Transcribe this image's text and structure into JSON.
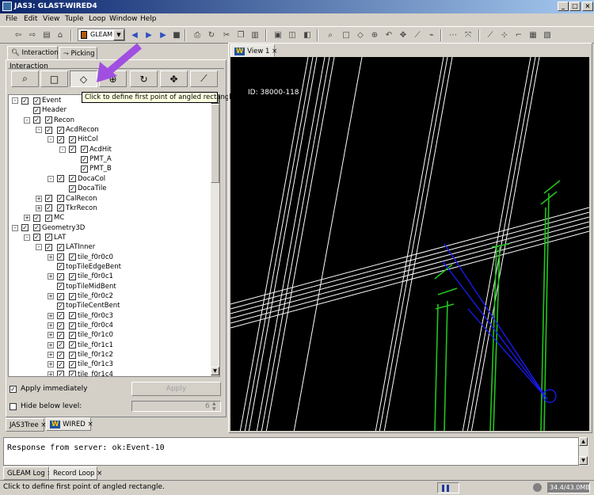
{
  "window": {
    "title": "JAS3: GLAST-WIRED4",
    "min": "_",
    "max": "□",
    "close": "×"
  },
  "menu": [
    "File",
    "Edit",
    "View",
    "Tuple",
    "Loop",
    "Window",
    "Help"
  ],
  "toolbar": {
    "combo_value": "GLEAM"
  },
  "left_panel": {
    "tabs": [
      "Interaction",
      "Picking"
    ],
    "group_label": "Interaction",
    "tooltip": "Click to define first point of angled rectangle.",
    "tree": [
      {
        "label": "Event",
        "level": 0,
        "exp": "-",
        "checks": 2
      },
      {
        "label": "Header",
        "level": 1,
        "exp": "",
        "checks": 1
      },
      {
        "label": "Recon",
        "level": 1,
        "exp": "-",
        "checks": 2
      },
      {
        "label": "AcdRecon",
        "level": 2,
        "exp": "-",
        "checks": 2
      },
      {
        "label": "HitCol",
        "level": 3,
        "exp": "-",
        "checks": 2
      },
      {
        "label": "AcdHit",
        "level": 4,
        "exp": "-",
        "checks": 2
      },
      {
        "label": "PMT_A",
        "level": 5,
        "exp": "",
        "checks": 1
      },
      {
        "label": "PMT_B",
        "level": 5,
        "exp": "",
        "checks": 1
      },
      {
        "label": "DocaCol",
        "level": 3,
        "exp": "-",
        "checks": 2
      },
      {
        "label": "DocaTile",
        "level": 4,
        "exp": "",
        "checks": 1
      },
      {
        "label": "CalRecon",
        "level": 2,
        "exp": "+",
        "checks": 2
      },
      {
        "label": "TkrRecon",
        "level": 2,
        "exp": "+",
        "checks": 2
      },
      {
        "label": "MC",
        "level": 1,
        "exp": "+",
        "checks": 2
      },
      {
        "label": "Geometry3D",
        "level": 0,
        "exp": "-",
        "checks": 2
      },
      {
        "label": "LAT",
        "level": 1,
        "exp": "-",
        "checks": 2
      },
      {
        "label": "LATInner",
        "level": 2,
        "exp": "-",
        "checks": 2
      },
      {
        "label": "tile_f0r0c0",
        "level": 3,
        "exp": "+",
        "checks": 2
      },
      {
        "label": "topTileEdgeBent",
        "level": 3,
        "exp": "",
        "checks": 1
      },
      {
        "label": "tile_f0r0c1",
        "level": 3,
        "exp": "+",
        "checks": 2
      },
      {
        "label": "topTileMidBent",
        "level": 3,
        "exp": "",
        "checks": 1
      },
      {
        "label": "tile_f0r0c2",
        "level": 3,
        "exp": "+",
        "checks": 2
      },
      {
        "label": "topTileCentBent",
        "level": 3,
        "exp": "",
        "checks": 1
      },
      {
        "label": "tile_f0r0c3",
        "level": 3,
        "exp": "+",
        "checks": 2
      },
      {
        "label": "tile_f0r0c4",
        "level": 3,
        "exp": "+",
        "checks": 2
      },
      {
        "label": "tile_f0r1c0",
        "level": 3,
        "exp": "+",
        "checks": 2
      },
      {
        "label": "tile_f0r1c1",
        "level": 3,
        "exp": "+",
        "checks": 2
      },
      {
        "label": "tile_f0r1c2",
        "level": 3,
        "exp": "+",
        "checks": 2
      },
      {
        "label": "tile_f0r1c3",
        "level": 3,
        "exp": "+",
        "checks": 2
      },
      {
        "label": "tile_f0r1c4",
        "level": 3,
        "exp": "+",
        "checks": 2
      }
    ],
    "apply_immediately_label": "Apply immediately",
    "apply_button": "Apply",
    "hide_below_label": "Hide below level:",
    "hide_below_value": "6",
    "bottom_tabs": [
      "JAS3Tree",
      "WIRED"
    ]
  },
  "view": {
    "tab_label": "View 1",
    "event_id": "ID: 38000-118"
  },
  "log": {
    "text": "Response from server: ok:Event-10",
    "tabs": [
      "GLEAM Log",
      "Record Loop"
    ]
  },
  "status": {
    "text": "Click to define first point of angled rectangle.",
    "memory": "34.4/43.0MB"
  },
  "colors": {
    "accent": "#a04fe0",
    "green": "#22c41e",
    "blue": "#1a1aff"
  }
}
